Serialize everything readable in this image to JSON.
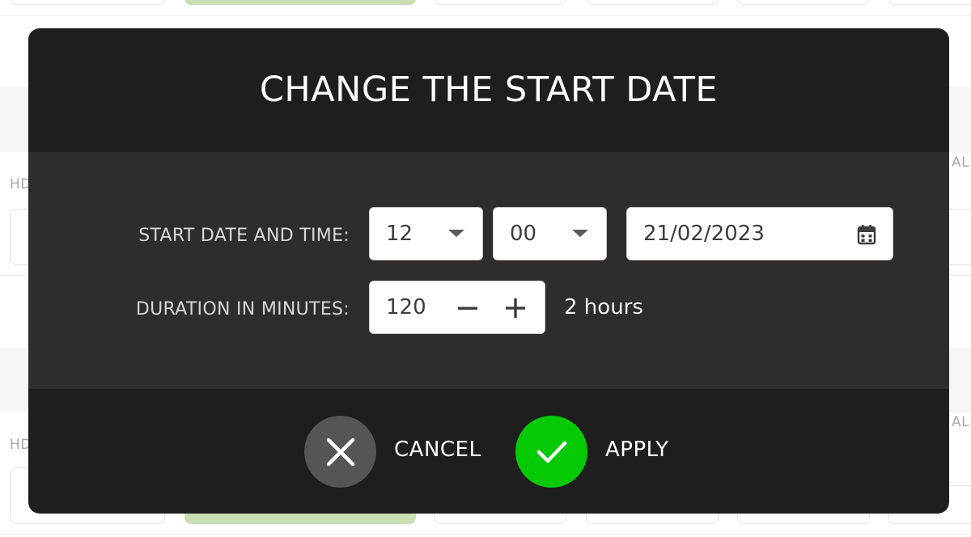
{
  "background": {
    "row_label_1": "HD",
    "row_label_2": "HD",
    "right_label_1": "AL",
    "right_label_2": "AL"
  },
  "dialog": {
    "title": "CHANGE THE START DATE",
    "start": {
      "label": "START DATE AND TIME:",
      "hour": "12",
      "minute": "00",
      "date": "21/02/2023",
      "date_icon": "calendar-icon"
    },
    "duration": {
      "label": "DURATION IN MINUTES:",
      "value": "120",
      "decrement_icon": "minus-icon",
      "increment_icon": "plus-icon",
      "readable": "2 hours"
    },
    "cancel": {
      "label": "CANCEL",
      "icon": "close-icon",
      "color": "#555555"
    },
    "apply": {
      "label": "APPLY",
      "icon": "check-icon",
      "color": "#05c905"
    }
  },
  "colors": {
    "modal_bg": "#1e1e1e",
    "body_bg": "#2e2d2b",
    "accent_green": "#05c905",
    "bg_button_green": "#c9dfb3"
  }
}
